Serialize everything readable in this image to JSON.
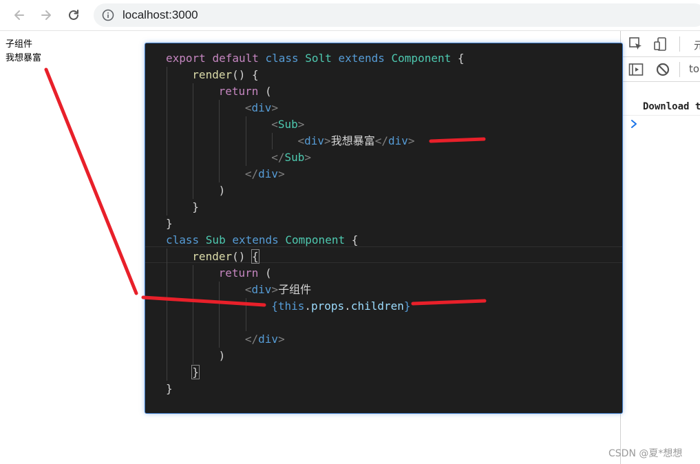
{
  "browser": {
    "url": "localhost:3000",
    "back_icon": "arrow-left-icon",
    "forward_icon": "arrow-right-icon",
    "reload_icon": "reload-icon",
    "info_icon": "info-icon"
  },
  "page": {
    "lines": [
      "子组件",
      "我想暴富"
    ]
  },
  "devtools": {
    "tab_truncated": "元",
    "context_truncated": "to",
    "console_message": "Download t",
    "icons": [
      "inspect-element-icon",
      "device-toolbar-icon",
      "sidebar-toggle-icon",
      "clear-console-icon",
      "console-prompt-icon"
    ]
  },
  "code": {
    "lines": [
      [
        [
          "kw",
          "export "
        ],
        [
          "kw",
          "default "
        ],
        [
          "kw2",
          "class "
        ],
        [
          "cls",
          "Solt "
        ],
        [
          "kw2",
          "extends "
        ],
        [
          "cls",
          "Component "
        ],
        [
          "pun",
          "{"
        ]
      ],
      [
        [
          "fn",
          "render"
        ],
        [
          "pun",
          "() {"
        ]
      ],
      [
        [
          "kw",
          "return "
        ],
        [
          "pun",
          "("
        ]
      ],
      [
        [
          "ang",
          "<"
        ],
        [
          "tag",
          "div"
        ],
        [
          "ang",
          ">"
        ]
      ],
      [
        [
          "ang",
          "<"
        ],
        [
          "cls",
          "Sub"
        ],
        [
          "ang",
          ">"
        ]
      ],
      [
        [
          "ang",
          "<"
        ],
        [
          "tag",
          "div"
        ],
        [
          "ang",
          ">"
        ],
        [
          "txt",
          "我想暴富"
        ],
        [
          "ang",
          "</"
        ],
        [
          "tag",
          "div"
        ],
        [
          "ang",
          ">"
        ]
      ],
      [
        [
          "ang",
          "</"
        ],
        [
          "cls",
          "Sub"
        ],
        [
          "ang",
          ">"
        ]
      ],
      [
        [
          "ang",
          "</"
        ],
        [
          "tag",
          "div"
        ],
        [
          "ang",
          ">"
        ]
      ],
      [
        [
          "pun",
          ")"
        ]
      ],
      [
        [
          "pun",
          "}"
        ]
      ],
      [
        [
          "pun",
          "}"
        ]
      ],
      [
        [
          "kw2",
          "class "
        ],
        [
          "cls",
          "Sub "
        ],
        [
          "kw2",
          "extends "
        ],
        [
          "cls",
          "Component "
        ],
        [
          "pun",
          "{"
        ]
      ],
      [
        [
          "fn",
          "render"
        ],
        [
          "pun",
          "() "
        ],
        [
          "pun",
          "{"
        ]
      ],
      [
        [
          "kw",
          "return "
        ],
        [
          "pun",
          "("
        ]
      ],
      [
        [
          "ang",
          "<"
        ],
        [
          "tag",
          "div"
        ],
        [
          "ang",
          ">"
        ],
        [
          "txt",
          "子组件"
        ]
      ],
      [
        [
          "kw2",
          "{this"
        ],
        [
          "pun",
          "."
        ],
        [
          "prop",
          "props"
        ],
        [
          "pun",
          "."
        ],
        [
          "prop",
          "children"
        ],
        [
          "kw2",
          "}"
        ]
      ],
      [
        [
          "txt",
          ""
        ]
      ],
      [
        [
          "ang",
          "</"
        ],
        [
          "tag",
          "div"
        ],
        [
          "ang",
          ">"
        ]
      ],
      [
        [
          "pun",
          ")"
        ]
      ],
      [
        [
          "pun",
          "}"
        ]
      ],
      [
        [
          "pun",
          "}"
        ]
      ]
    ]
  },
  "watermark": "CSDN @夏*想想",
  "colors": {
    "editor_bg": "#1e1e1e",
    "annotation_red": "#e8202a",
    "keyword": "#c586c0",
    "type": "#4ec9b0",
    "function": "#dcdcaa",
    "tag": "#569cd6"
  }
}
